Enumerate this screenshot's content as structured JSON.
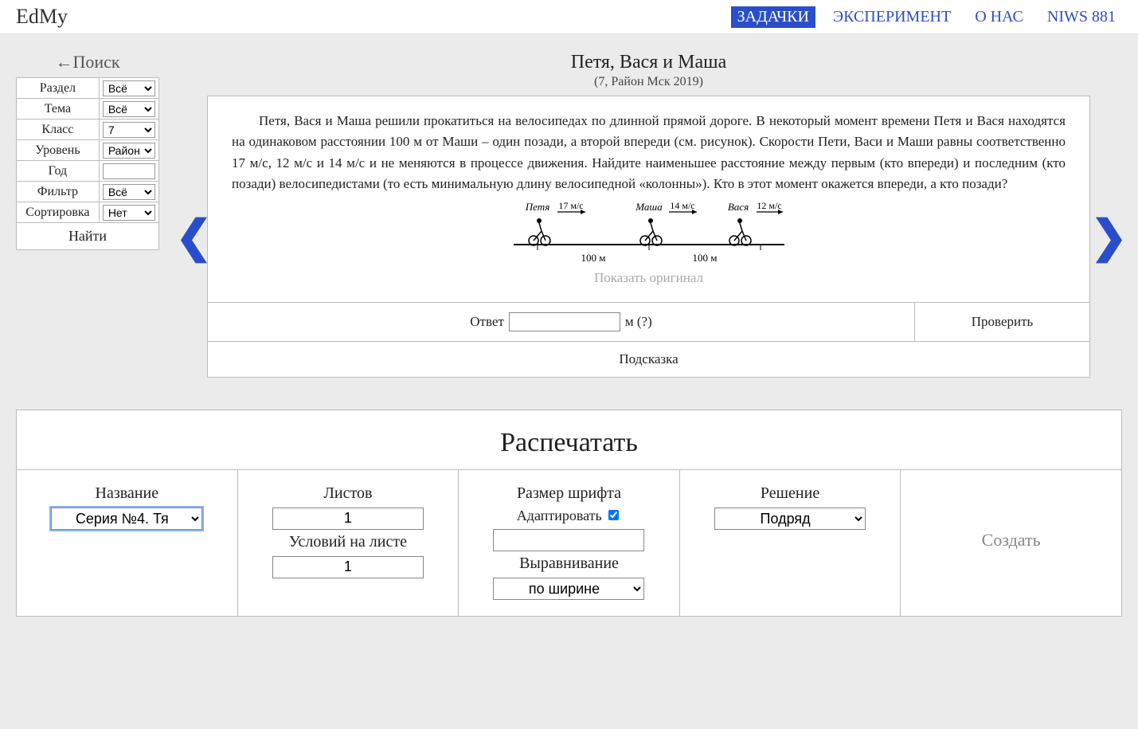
{
  "header": {
    "brand": "EdMy",
    "nav": {
      "tasks": "ЗАДАЧКИ",
      "experiment": "ЭКСПЕРИМЕНТ",
      "about": "О НАС",
      "niws": "NIWS 881"
    }
  },
  "search": {
    "title": "←Поиск",
    "rows": {
      "section": "Раздел",
      "topic": "Тема",
      "grade": "Класс",
      "level": "Уровень",
      "year": "Год",
      "filter": "Фильтр",
      "sort": "Сортировка"
    },
    "values": {
      "section": "Всё",
      "topic": "Всё",
      "grade": "7",
      "level": "Район М",
      "year": "",
      "filter": "Всё",
      "sort": "Нет"
    },
    "find": "Найти"
  },
  "problem": {
    "title": "Петя, Вася и Маша",
    "subtitle": "(7, Район Мск 2019)",
    "text": "Петя, Вася и Маша решили прокатиться на велосипедах по длинной прямой дороге. В некоторый момент времени Петя и Вася находятся на одинаковом расстоянии 100 м от Маши – один позади, а второй впереди (см. рисунок). Скорости Пети, Васи и Маши равны соответственно 17 м/с, 12 м/с и 14 м/с и не меняются в процессе движения. Найдите наименьшее расстояние между первым (кто впереди) и последним (кто позади) велосипедистами (то есть минимальную длину велосипедной «колонны»). Кто в этот момент окажется впереди, а кто позади?",
    "diagram": {
      "riders": [
        {
          "name": "Петя",
          "speed": "17 м/с"
        },
        {
          "name": "Маша",
          "speed": "14 м/с"
        },
        {
          "name": "Вася",
          "speed": "12 м/с"
        }
      ],
      "dist": "100 м"
    },
    "show_original": "Показать оригинал",
    "answer_label": "Ответ",
    "answer_unit": "м (?)",
    "check": "Проверить",
    "hint": "Подсказка"
  },
  "print": {
    "title": "Распечатать",
    "name_label": "Название",
    "name_value": "Серия №4. Тя",
    "sheets_label": "Листов",
    "sheets_value": "1",
    "per_sheet_label": "Условий на листе",
    "per_sheet_value": "1",
    "font_label": "Размер шрифта",
    "adapt_label": "Адаптировать",
    "align_label": "Выравнивание",
    "align_value": "по ширине",
    "solution_label": "Решение",
    "solution_value": "Подряд",
    "create": "Создать"
  }
}
